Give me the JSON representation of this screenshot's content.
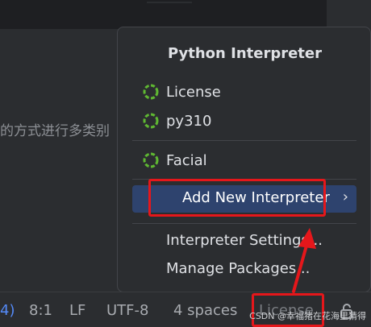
{
  "editor": {
    "text_fragment": "的方式进行多类别"
  },
  "popup": {
    "title": "Python Interpreter",
    "interpreters": [
      {
        "label": "License",
        "icon": "spinner-icon"
      },
      {
        "label": "py310",
        "icon": "spinner-icon"
      }
    ],
    "other_interpreters": [
      {
        "label": "Facial",
        "icon": "spinner-icon"
      }
    ],
    "selected_action": {
      "label": "Add New Interpreter",
      "chevron": "›"
    },
    "actions": [
      {
        "label": "Interpreter Settings..."
      },
      {
        "label": "Manage Packages..."
      }
    ]
  },
  "statusbar": {
    "fragment": "4)",
    "position": "8:1",
    "line_ending": "LF",
    "encoding": "UTF-8",
    "indent": "4 spaces",
    "interpreter": "License",
    "lock_icon": "lock-icon"
  },
  "watermark": "CSDN @幸福猪在花海里猜得",
  "colors": {
    "accent_selection": "#2e436e",
    "annotation_red": "#e5171b",
    "spinner_green": "#5fb832",
    "link_blue": "#548af7"
  }
}
